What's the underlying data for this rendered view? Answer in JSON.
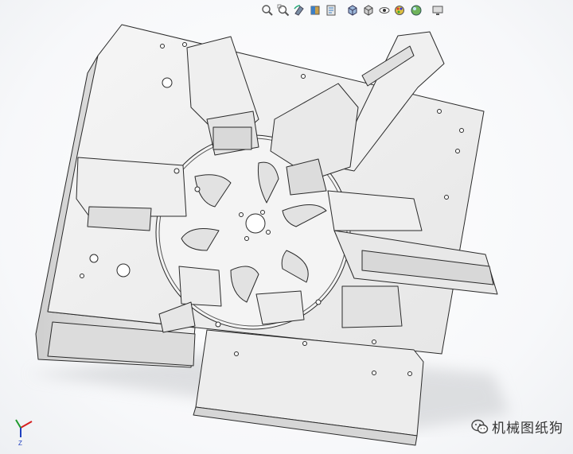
{
  "app": {
    "type": "cad-3d-viewport"
  },
  "heads_up_toolbar": {
    "buttons": [
      {
        "icon": "zoom-to-fit-icon"
      },
      {
        "icon": "zoom-to-area-icon"
      },
      {
        "icon": "previous-view-icon"
      },
      {
        "icon": "section-view-icon"
      },
      {
        "icon": "dynamic-annotation-views-icon"
      },
      {
        "icon": "view-orientation-icon"
      },
      {
        "icon": "display-style-icon"
      },
      {
        "icon": "hide-show-items-icon"
      },
      {
        "icon": "edit-appearance-icon"
      },
      {
        "icon": "apply-scene-icon"
      },
      {
        "icon": "view-settings-icon"
      }
    ]
  },
  "triad": {
    "axes": [
      "X",
      "Y",
      "Z"
    ],
    "colors": {
      "x": "#d62020",
      "y": "#1f9a2e",
      "z": "#1f3fbf"
    },
    "label": "Z"
  },
  "watermark": {
    "icon": "wechat-icon",
    "text": "机械图纸狗"
  },
  "colors": {
    "part_fill": "#f2f2f2",
    "edge": "#2a2a2a",
    "shadow": "#c7c9cc"
  }
}
